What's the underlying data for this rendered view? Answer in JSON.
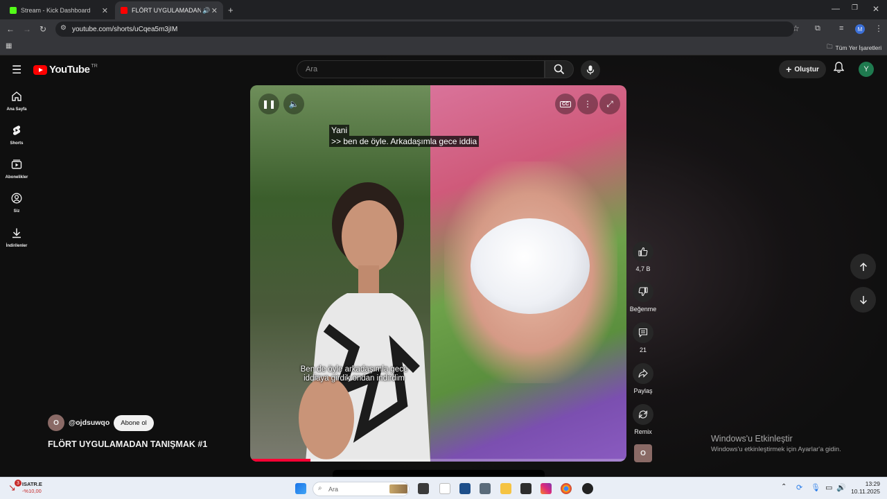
{
  "browser": {
    "tabs": [
      {
        "title": "Stream - Kick Dashboard",
        "active": false
      },
      {
        "title": "FLÖRT UYGULAMADAN TA",
        "active": true
      }
    ],
    "url": "youtube.com/shorts/uCqea5m3jIM",
    "bookmarks_all": "Tüm Yer İşaretleri",
    "profile_letter": "M"
  },
  "youtube": {
    "logo_text": "YouTube",
    "region": "TR",
    "search_placeholder": "Ara",
    "create_label": "Oluştur",
    "avatar_letter": "Y",
    "sidebar": [
      {
        "label": "Ana Sayfa",
        "icon": "home-icon"
      },
      {
        "label": "Shorts",
        "icon": "shorts-icon"
      },
      {
        "label": "Abonelikler",
        "icon": "subscriptions-icon"
      },
      {
        "label": "Siz",
        "icon": "you-icon"
      },
      {
        "label": "İndirilenler",
        "icon": "download-icon"
      }
    ]
  },
  "video": {
    "caption_line1": "Yani",
    "caption_line2": ">> ben de öyle. Arkadaşımla gece iddia",
    "overlay_text": "Ben de öyle arkadaşımla gece iddiaya girdik ondan indirdim",
    "progress": 0.16,
    "channel_initial": "O",
    "channel_name": "@ojdsuwqo",
    "subscribe_label": "Abone ol",
    "title": "FLÖRT UYGULAMADAN TANIŞMAK #1"
  },
  "actions": {
    "likes": "4,7 B",
    "dislike_label": "Beğenme",
    "comments": "21",
    "share_label": "Paylaş",
    "remix_label": "Remix"
  },
  "windows": {
    "activate_title": "Windows'u Etkinleştir",
    "activate_sub": "Windows'u etkinleştirmek için Ayarlar'a gidin.",
    "stock_name": "ISATR.E",
    "stock_change": "-%10,00",
    "stock_badge": "3",
    "search_label": "Ara",
    "time": "13:29",
    "date": "10.11.2025"
  }
}
